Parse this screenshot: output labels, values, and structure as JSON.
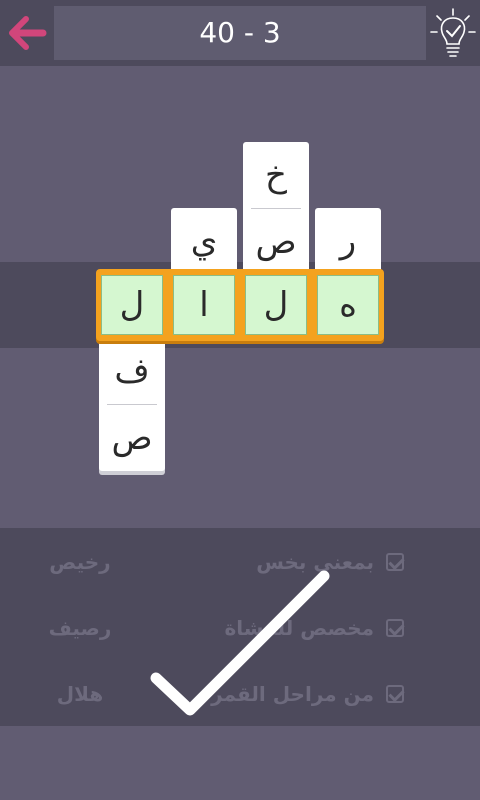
{
  "header": {
    "level": "40 - 3",
    "back_icon": "arrow-left-icon",
    "hint_icon": "lightbulb-check-icon",
    "accent": "#d1467b"
  },
  "grid": {
    "col1": [
      "ف",
      "ص"
    ],
    "col2": [
      "ي"
    ],
    "col3": [
      "خ",
      "ص"
    ],
    "col4": [
      "ر"
    ],
    "answer": [
      "ل",
      "ا",
      "ل",
      "ه"
    ]
  },
  "clues": [
    {
      "text": "بمعنى بخس",
      "answer": "رخيص"
    },
    {
      "text": "مخصص للمشاة",
      "answer": "رصيف"
    },
    {
      "text": "من مراحل القمر",
      "answer": "هلال"
    }
  ],
  "colors": {
    "tile_green": "#d5f7d0",
    "answer_frame": "#f4a21e"
  }
}
